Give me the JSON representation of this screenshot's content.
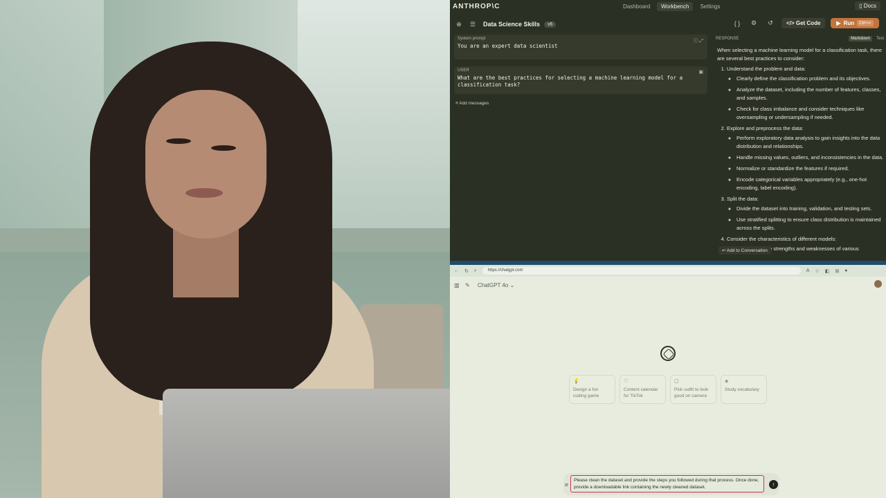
{
  "workbench": {
    "logo": "ANTHROP\\C",
    "nav": {
      "dashboard": "Dashboard",
      "workbench": "Workbench",
      "settings": "Settings",
      "docs": "Docs"
    },
    "project_title": "Data Science Skills",
    "version": "v6",
    "get_code": "Get Code",
    "run": "Run",
    "run_shortcut": "Ctrl+↵",
    "system_label": "System prompt",
    "system_text": "You are an expert data scientist",
    "user_label": "USER",
    "user_text": "What are the best practices for selecting a machine learning model for a classification task?",
    "add_messages": "Add messages",
    "response_label": "RESPONSE",
    "toggle": {
      "markdown": "Markdown",
      "text": "Text"
    },
    "response": {
      "intro": "When selecting a machine learning model for a classification task, there are several best practices to consider:",
      "steps": [
        {
          "title": "Understand the problem and data:",
          "bullets": [
            "Clearly define the classification problem and its objectives.",
            "Analyze the dataset, including the number of features, classes, and samples.",
            "Check for class imbalance and consider techniques like oversampling or undersampling if needed."
          ]
        },
        {
          "title": "Explore and preprocess the data:",
          "bullets": [
            "Perform exploratory data analysis to gain insights into the data distribution and relationships.",
            "Handle missing values, outliers, and inconsistencies in the data.",
            "Normalize or standardize the features if required.",
            "Encode categorical variables appropriately (e.g., one-hot encoding, label encoding)."
          ]
        },
        {
          "title": "Split the data:",
          "bullets": [
            "Divide the dataset into training, validation, and testing sets.",
            "Use stratified splitting to ensure class distribution is maintained across the splits."
          ]
        },
        {
          "title": "Consider the characteristics of different models:",
          "bullets": [
            "Understand the strengths and weaknesses of various"
          ]
        }
      ]
    },
    "add_to_conversation": "Add to Conversation"
  },
  "browser": {
    "url": "https://chatgpt.com",
    "model": "ChatGPT 4o",
    "suggestions": [
      {
        "icon": "lightbulb-icon",
        "glyph": "💡",
        "text": "Design a fun coding game"
      },
      {
        "icon": "chat-icon",
        "glyph": "♡",
        "text": "Content calendar for TikTok"
      },
      {
        "icon": "image-icon",
        "glyph": "▢",
        "text": "Pick outfit to look good on camera"
      },
      {
        "icon": "book-icon",
        "glyph": "◈",
        "text": "Study vocabulary"
      }
    ],
    "prompt": "Please clean the dataset and provide the steps you followed during that process. Once done, provide a downloadable link containing the newly cleaned dataset."
  }
}
